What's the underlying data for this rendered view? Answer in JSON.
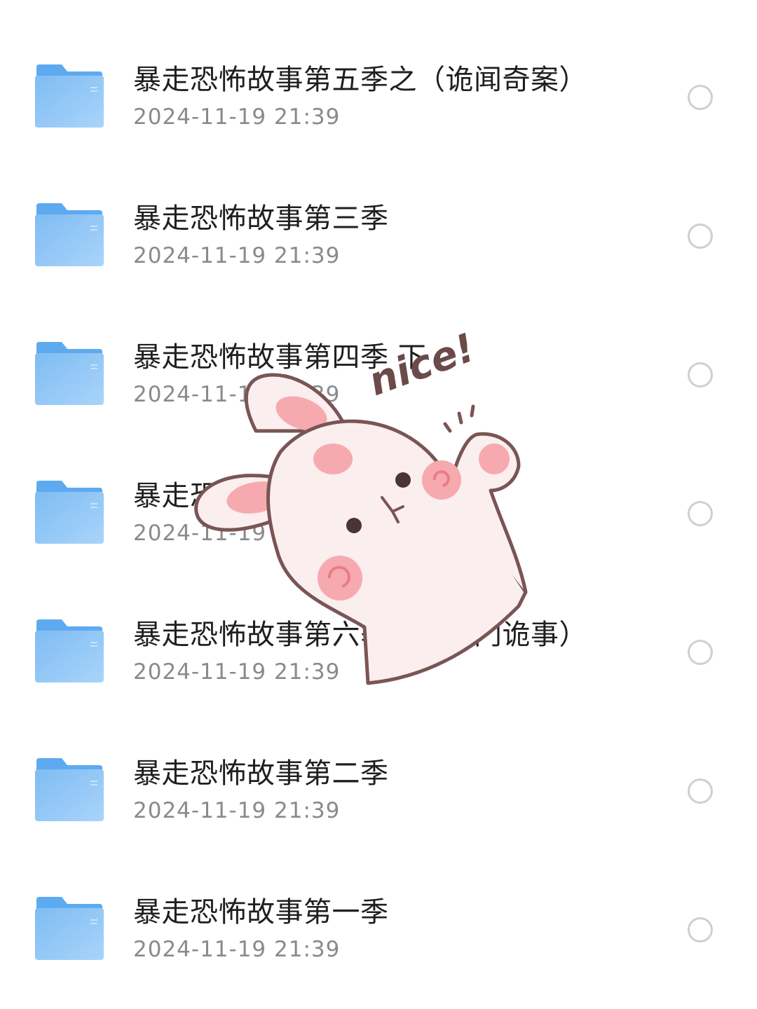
{
  "icons": {
    "folder": "folder-icon",
    "select": "radio-circle-icon",
    "sticker": "bunny-sticker"
  },
  "colors": {
    "folder_front": "#8ec6f7",
    "folder_back": "#5eaaf0",
    "title": "#1f1f1f",
    "date": "#8a8a8a",
    "radio_border": "#cfcfcf"
  },
  "files": [
    {
      "title": "暴走恐怖故事第五季之（诡闻奇案）",
      "date": "2024-11-19 21:39"
    },
    {
      "title": "暴走恐怖故事第三季",
      "date": "2024-11-19 21:39"
    },
    {
      "title": "暴走恐怖故事第四季 下",
      "date": "2024-11-19 21:39"
    },
    {
      "title": "暴走恐怖故事第四季 上",
      "date": "2024-11-19 21:39"
    },
    {
      "title": "暴走恐怖故事第六季之（豪门诡事）",
      "date": "2024-11-19 21:39"
    },
    {
      "title": "暴走恐怖故事第二季",
      "date": "2024-11-19 21:39"
    },
    {
      "title": "暴走恐怖故事第一季",
      "date": "2024-11-19 21:39"
    }
  ],
  "sticker": {
    "caption": "nice!"
  }
}
